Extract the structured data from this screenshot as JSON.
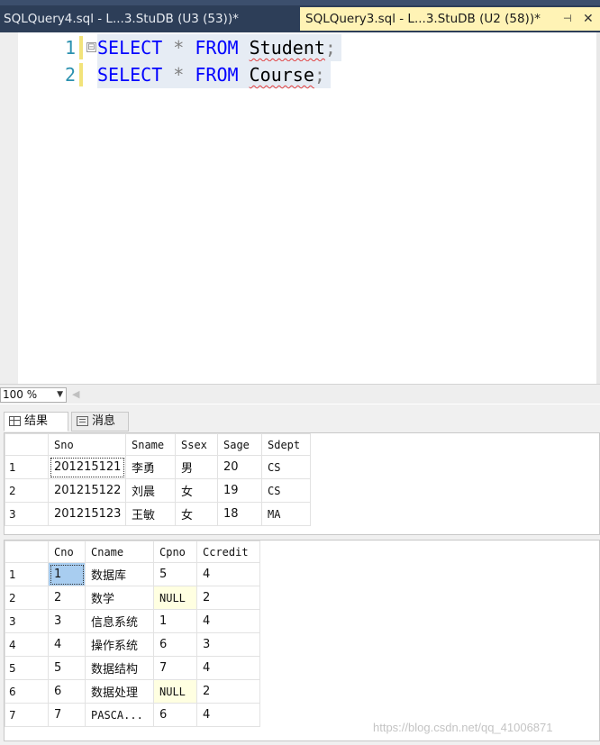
{
  "tabs": {
    "inactive": "SQLQuery4.sql - L...3.StuDB (U3 (53))*",
    "active": "SQLQuery3.sql - L...3.StuDB (U2 (58))*",
    "pin_glyph": "⊣",
    "close_glyph": "✕"
  },
  "editor": {
    "lines": [
      {
        "number": "1",
        "kw1": "SELECT",
        "star": "*",
        "kw2": "FROM",
        "table": "Student",
        "semi": ";"
      },
      {
        "number": "2",
        "kw1": "SELECT",
        "star": "*",
        "kw2": "FROM",
        "table": "Course",
        "semi": ";"
      }
    ],
    "fold_glyph": "⊟"
  },
  "zoom": {
    "value": "100 %",
    "arrow": "▼",
    "scroll_left": "◀"
  },
  "results": {
    "tabs": [
      "结果",
      "消息"
    ],
    "student": {
      "columns": [
        "Sno",
        "Sname",
        "Ssex",
        "Sage",
        "Sdept"
      ],
      "rows": [
        [
          "1",
          "201215121",
          "李勇",
          "男",
          "20",
          "CS"
        ],
        [
          "2",
          "201215122",
          "刘晨",
          "女",
          "19",
          "CS"
        ],
        [
          "3",
          "201215123",
          "王敏",
          "女",
          "18",
          "MA"
        ]
      ]
    },
    "course": {
      "columns": [
        "Cno",
        "Cname",
        "Cpno",
        "Ccredit"
      ],
      "rows": [
        [
          "1",
          "1",
          "数据库",
          "5",
          "4"
        ],
        [
          "2",
          "2",
          "数学",
          "NULL",
          "2"
        ],
        [
          "3",
          "3",
          "信息系统",
          "1",
          "4"
        ],
        [
          "4",
          "4",
          "操作系统",
          "6",
          "3"
        ],
        [
          "5",
          "5",
          "数据结构",
          "7",
          "4"
        ],
        [
          "6",
          "6",
          "数据处理",
          "NULL",
          "2"
        ],
        [
          "7",
          "7",
          "PASCA...",
          "6",
          "4"
        ]
      ]
    }
  },
  "watermark": "https://blog.csdn.net/qq_41006871",
  "colors": {
    "tabbar": "#2d3e58",
    "active_tab": "#fff3b5",
    "keyword": "#0000ff",
    "line_number": "#2b91af",
    "cell_selected": "#a8cdf0",
    "null_cell": "#ffffe1"
  }
}
